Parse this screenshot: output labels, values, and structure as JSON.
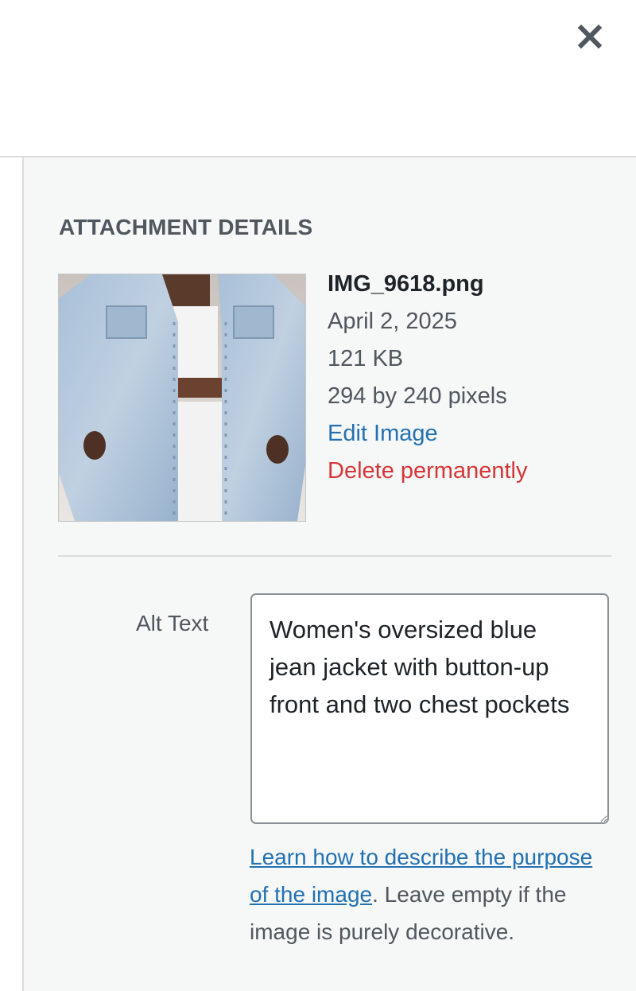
{
  "close_icon": "close-icon",
  "attachment": {
    "section_title": "ATTACHMENT DETAILS",
    "filename": "IMG_9618.png",
    "date": "April 2, 2025",
    "filesize": "121 KB",
    "dimensions": "294 by 240 pixels",
    "edit_label": "Edit Image",
    "delete_label": "Delete permanently"
  },
  "alt_text": {
    "label": "Alt Text",
    "value": "Women's oversized blue jean jacket with button-up front and two chest pockets",
    "help_link": "Learn how to describe the purpose of the image",
    "help_suffix": ". Leave empty if the image is purely decorative."
  },
  "colors": {
    "link": "#2271b1",
    "delete": "#d63638",
    "sidebar_bg": "#f6f7f7"
  }
}
